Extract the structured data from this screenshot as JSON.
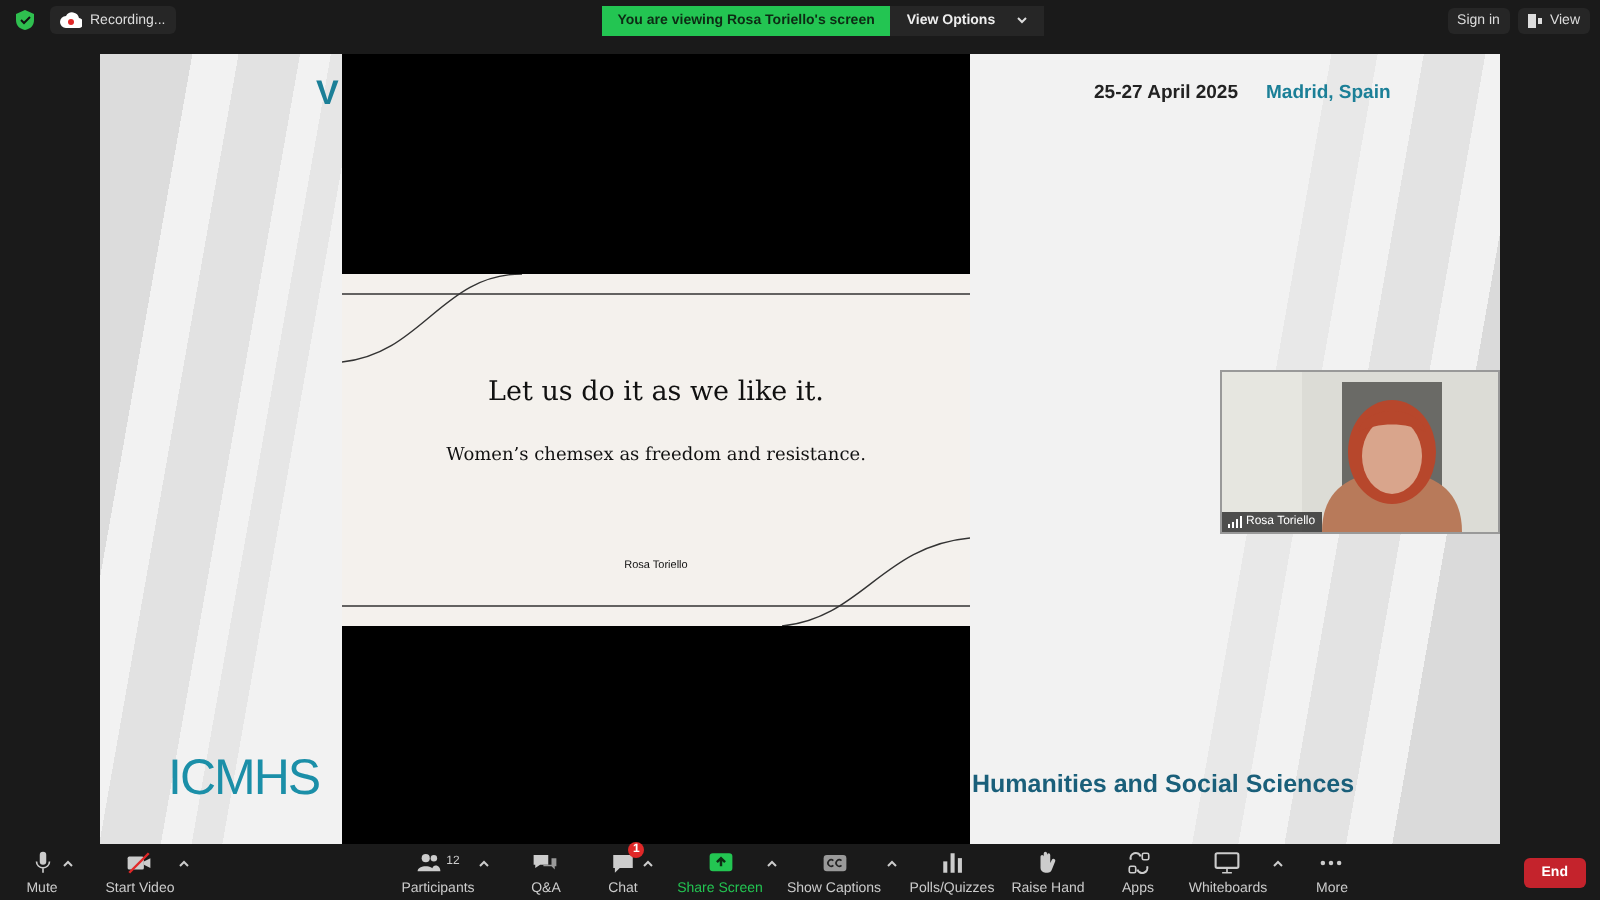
{
  "top_bar": {
    "recording": "Recording...",
    "banner": "You are viewing Rosa Toriello's screen",
    "view_options": "View Options",
    "sign_in": "Sign in",
    "view": "View"
  },
  "shared_screen": {
    "header": {
      "partial_title": "V",
      "dates": "25-27 April 2025",
      "location": "Madrid, Spain"
    },
    "logo": "ICMHS",
    "footer": "Humanities and Social Sciences",
    "inner_slide": {
      "title": "Let us do it as we like it.",
      "subtitle": "Women’s chemsex as freedom and resistance.",
      "author": "Rosa Toriello"
    }
  },
  "video_tile": {
    "name": "Rosa Toriello"
  },
  "toolbar": {
    "items": [
      {
        "label": "Mute",
        "kind": "mic",
        "caret": true,
        "accent": false
      },
      {
        "label": "Start Video",
        "kind": "video-off",
        "caret": true,
        "accent": false
      },
      {
        "label": "Participants",
        "kind": "people",
        "caret": true,
        "accent": false,
        "count": "12"
      },
      {
        "label": "Q&A",
        "kind": "qa",
        "caret": false,
        "accent": false
      },
      {
        "label": "Chat",
        "kind": "chat",
        "caret": true,
        "accent": false,
        "badge": "1"
      },
      {
        "label": "Share Screen",
        "kind": "share",
        "caret": true,
        "accent": true
      },
      {
        "label": "Show Captions",
        "kind": "cc",
        "caret": true,
        "accent": false
      },
      {
        "label": "Polls/Quizzes",
        "kind": "polls",
        "caret": false,
        "accent": false
      },
      {
        "label": "Raise Hand",
        "kind": "hand",
        "caret": false,
        "accent": false
      },
      {
        "label": "Apps",
        "kind": "apps",
        "caret": false,
        "accent": false
      },
      {
        "label": "Whiteboards",
        "kind": "board",
        "caret": true,
        "accent": false
      },
      {
        "label": "More",
        "kind": "more",
        "caret": false,
        "accent": false
      }
    ],
    "end": "End"
  }
}
